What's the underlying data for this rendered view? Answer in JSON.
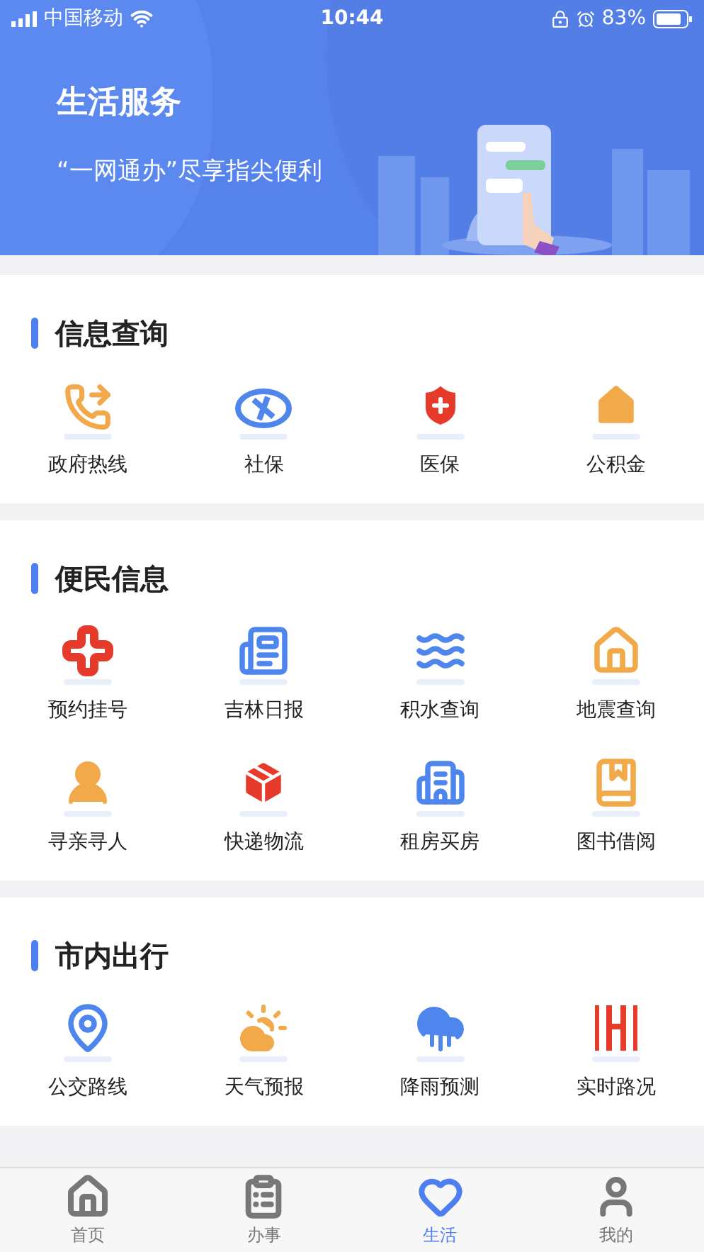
{
  "status_bar": {
    "carrier": "中国移动",
    "time": "10:44",
    "battery": "83%"
  },
  "header": {
    "title": "生活服务",
    "subtitle": "“一网通办”尽享指尖便利"
  },
  "sections": [
    {
      "title": "信息查询",
      "items": [
        {
          "label": "政府热线"
        },
        {
          "label": "社保"
        },
        {
          "label": "医保"
        },
        {
          "label": "公积金"
        }
      ]
    },
    {
      "title": "便民信息",
      "items": [
        {
          "label": "预约挂号"
        },
        {
          "label": "吉林日报"
        },
        {
          "label": "积水查询"
        },
        {
          "label": "地震查询"
        },
        {
          "label": "寻亲寻人"
        },
        {
          "label": "快递物流"
        },
        {
          "label": "租房买房"
        },
        {
          "label": "图书借阅"
        }
      ]
    },
    {
      "title": "市内出行",
      "items": [
        {
          "label": "公交路线"
        },
        {
          "label": "天气预报"
        },
        {
          "label": "降雨预测"
        },
        {
          "label": "实时路况"
        }
      ]
    }
  ],
  "tab_bar": [
    {
      "label": "首页",
      "selected": false
    },
    {
      "label": "办事",
      "selected": false
    },
    {
      "label": "生活",
      "selected": true
    },
    {
      "label": "我的",
      "selected": false
    }
  ]
}
